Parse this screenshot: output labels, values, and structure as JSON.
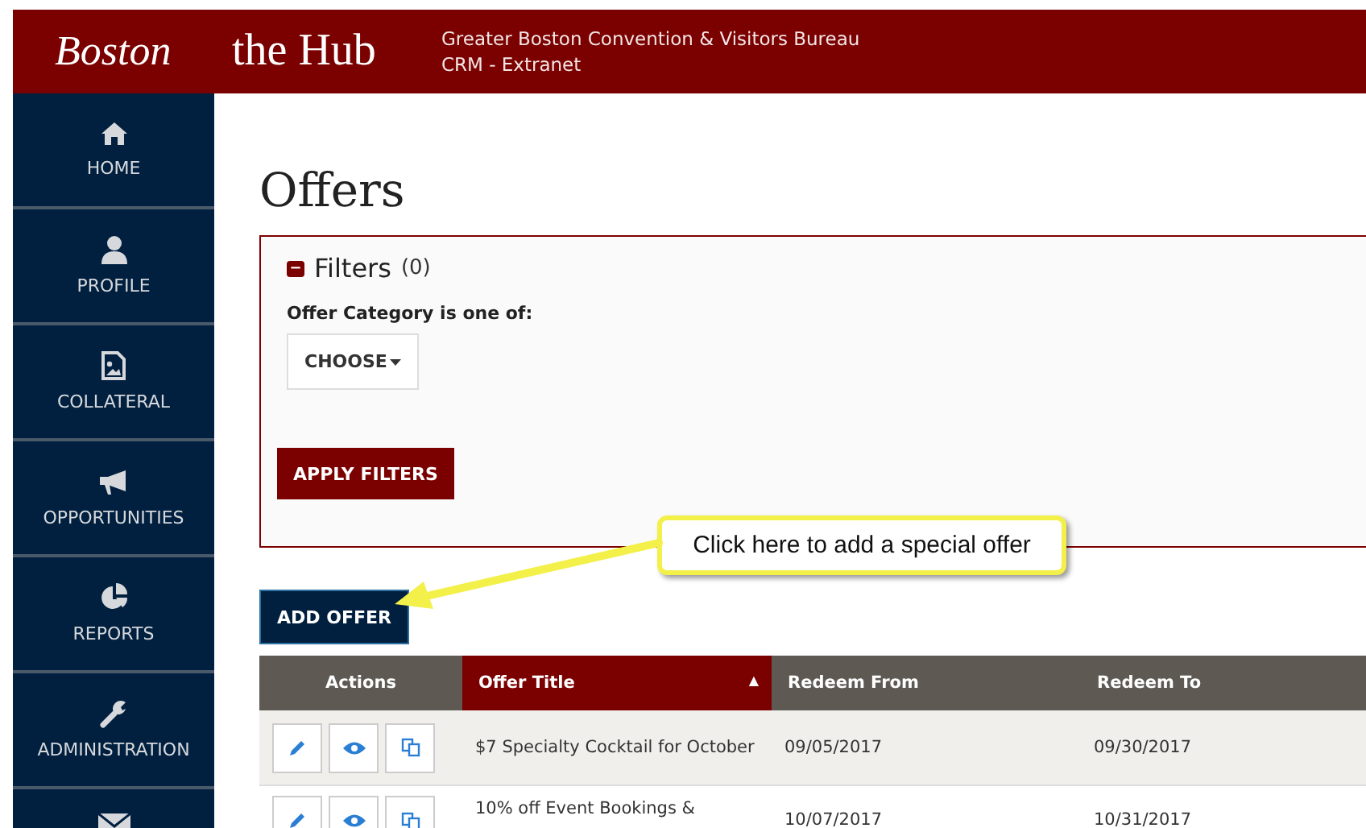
{
  "header": {
    "logo_city": "Boston",
    "logo_hub": "the Hub",
    "org_name": "Greater Boston Convention & Visitors Bureau",
    "subtitle": "CRM - Extranet"
  },
  "sidebar": {
    "items": [
      {
        "label": "HOME",
        "kind": "home"
      },
      {
        "label": "PROFILE",
        "kind": "profile"
      },
      {
        "label": "COLLATERAL",
        "kind": "collateral"
      },
      {
        "label": "OPPORTUNITIES",
        "kind": "megaphone"
      },
      {
        "label": "REPORTS",
        "kind": "pie"
      },
      {
        "label": "ADMINISTRATION",
        "kind": "wrench"
      },
      {
        "kind": "envelope"
      }
    ]
  },
  "page_title": "Offers",
  "filters": {
    "toggle": "−",
    "title": "Filters",
    "count": "(0)",
    "category_label": "Offer Category is one of:",
    "choose_button": "CHOOSE",
    "apply_button": "APPLY FILTERS"
  },
  "add_offer_button": "ADD OFFER",
  "callout": "Click here to add a special offer",
  "table": {
    "columns": [
      {
        "label": "Actions",
        "sorted": false
      },
      {
        "label": "Offer Title",
        "sorted": true,
        "sort_indicator": "▲"
      },
      {
        "label": "Redeem From",
        "sorted": false
      },
      {
        "label": "Redeem To",
        "sorted": false
      }
    ],
    "rows": [
      {
        "title": "$7 Specialty Cocktail for October",
        "redeem_from": "09/05/2017",
        "redeem_to": "09/30/2017"
      },
      {
        "title": "10% off Event Bookings &",
        "redeem_from": "10/07/2017",
        "redeem_to": "10/31/2017"
      }
    ]
  }
}
